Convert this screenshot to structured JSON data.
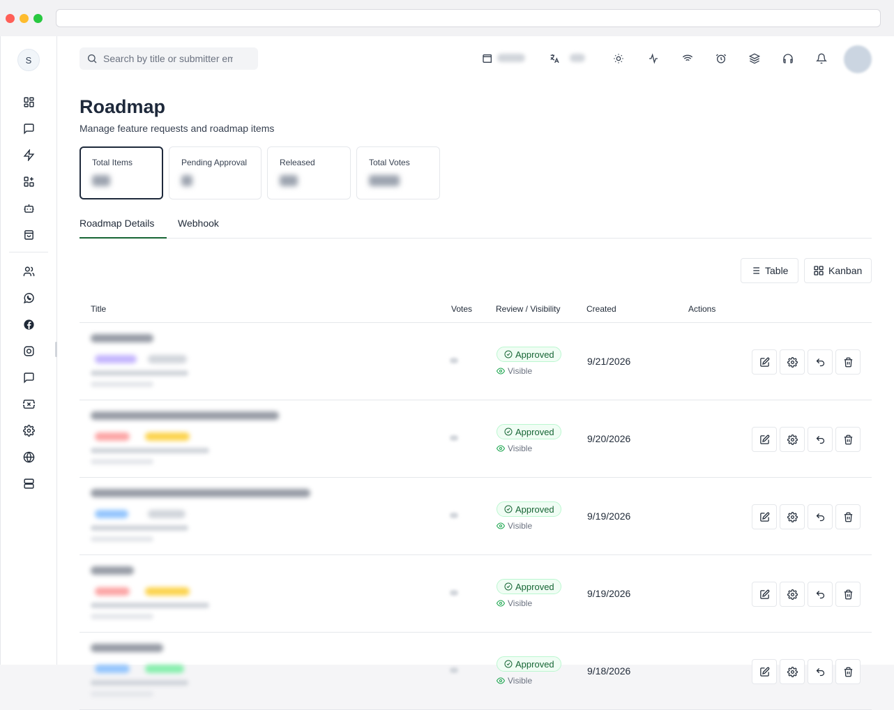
{
  "search": {
    "placeholder": "Search by title or submitter email"
  },
  "page": {
    "title": "Roadmap",
    "subtitle": "Manage feature requests and roadmap items"
  },
  "stats": [
    {
      "label": "Total Items",
      "active": true
    },
    {
      "label": "Pending Approval",
      "active": false
    },
    {
      "label": "Released",
      "active": false
    },
    {
      "label": "Total Votes",
      "active": false
    }
  ],
  "tabs": [
    {
      "label": "Roadmap Details",
      "active": true
    },
    {
      "label": "Webhook",
      "active": false
    }
  ],
  "views": {
    "table_label": "Table",
    "kanban_label": "Kanban"
  },
  "table": {
    "headers": {
      "title": "Title",
      "votes": "Votes",
      "review": "Review / Visibility",
      "created": "Created",
      "actions": "Actions"
    },
    "rows": [
      {
        "status": "Approved",
        "visibility": "Visible",
        "created": "9/21/2026"
      },
      {
        "status": "Approved",
        "visibility": "Visible",
        "created": "9/20/2026"
      },
      {
        "status": "Approved",
        "visibility": "Visible",
        "created": "9/19/2026"
      },
      {
        "status": "Approved",
        "visibility": "Visible",
        "created": "9/19/2026"
      },
      {
        "status": "Approved",
        "visibility": "Visible",
        "created": "9/18/2026"
      }
    ]
  },
  "sidebar": {
    "avatar_initial": "S",
    "icons": [
      "dashboard-icon",
      "message-square-icon",
      "zap-icon",
      "widgets-icon",
      "bot-icon",
      "shopping-bag-icon",
      "users-icon",
      "whatsapp-icon",
      "facebook-icon",
      "instagram-icon",
      "chat-icon",
      "ticket-icon",
      "settings-icon",
      "globe-icon",
      "server-icon"
    ]
  },
  "topbar": {
    "icons": [
      "wallet-icon",
      "translate-icon",
      "sun-icon",
      "activity-icon",
      "wifi-icon",
      "alarm-icon",
      "layers-icon",
      "headphones-icon",
      "bell-icon"
    ]
  }
}
